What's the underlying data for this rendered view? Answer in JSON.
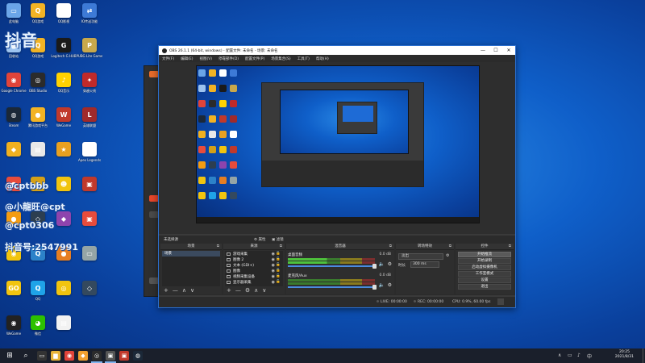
{
  "desktop": {
    "icons": [
      {
        "label": "此电脑",
        "color": "#6aa5e8",
        "glyph": "▭"
      },
      {
        "label": "QQ游戏",
        "color": "#f2b324",
        "glyph": "Q"
      },
      {
        "label": "QQ影视",
        "color": "#ffffff",
        "glyph": "▶"
      },
      {
        "label": "IO传送功能",
        "color": "#3d7ad6",
        "glyph": "⇄"
      },
      {
        "label": "回收站",
        "color": "#9cc3ef",
        "glyph": "🗑"
      },
      {
        "label": "QQ游戏",
        "color": "#f2b324",
        "glyph": "Q"
      },
      {
        "label": "Logitech G HUB",
        "color": "#1a1a1a",
        "glyph": "G"
      },
      {
        "label": "PUBG Lite Game",
        "color": "#c8a84b",
        "glyph": "P"
      },
      {
        "label": "Google Chrome",
        "color": "#e0443a",
        "glyph": "◉"
      },
      {
        "label": "OBS Studio",
        "color": "#2b2b2b",
        "glyph": "◎"
      },
      {
        "label": "QQ音乐",
        "color": "#ffd200",
        "glyph": "♪"
      },
      {
        "label": "穿越火线",
        "color": "#c02a2a",
        "glyph": "✦"
      },
      {
        "label": "Steam",
        "color": "#1b2838",
        "glyph": "◍"
      },
      {
        "label": "腾讯游戏平台",
        "color": "#f2b324",
        "glyph": "●"
      },
      {
        "label": "WeGame",
        "color": "#c0392b",
        "glyph": "W"
      },
      {
        "label": "英雄联盟",
        "color": "#a02a2a",
        "glyph": "L"
      },
      {
        "label": "",
        "color": "#f0b020",
        "glyph": "◆"
      },
      {
        "label": "",
        "color": "#e8e8e8",
        "glyph": "▤"
      },
      {
        "label": "",
        "color": "#e8a020",
        "glyph": "★"
      },
      {
        "label": "Apex Legends",
        "color": "#ffffff",
        "glyph": "▲"
      },
      {
        "label": "",
        "color": "#e74c3c",
        "glyph": "●"
      },
      {
        "label": "",
        "color": "#d4a017",
        "glyph": "◐"
      },
      {
        "label": "",
        "color": "#f1c40f",
        "glyph": "☻"
      },
      {
        "label": "",
        "color": "#c0392b",
        "glyph": "▣"
      },
      {
        "label": "",
        "color": "#f39c12",
        "glyph": "●"
      },
      {
        "label": "",
        "color": "#2c3e50",
        "glyph": "◇"
      },
      {
        "label": "",
        "color": "#8e44ad",
        "glyph": "◆"
      },
      {
        "label": "",
        "color": "#e74c3c",
        "glyph": "▣"
      },
      {
        "label": "",
        "color": "#f1c40f",
        "glyph": "◉"
      },
      {
        "label": "",
        "color": "#2c82c9",
        "glyph": "Q"
      },
      {
        "label": "",
        "color": "#e67e22",
        "glyph": "●"
      },
      {
        "label": "",
        "color": "#95a5a6",
        "glyph": "▭"
      },
      {
        "label": "",
        "color": "#f1c40f",
        "glyph": "GO"
      },
      {
        "label": "QQ",
        "color": "#1fa3e8",
        "glyph": "Q"
      },
      {
        "label": "",
        "color": "#f1c40f",
        "glyph": "◎"
      },
      {
        "label": "",
        "color": "#34495e",
        "glyph": "◇"
      },
      {
        "label": "WeGame",
        "color": "#222222",
        "glyph": "◉"
      },
      {
        "label": "微信",
        "color": "#2dc100",
        "glyph": "◕"
      },
      {
        "label": "",
        "color": "#f2f2f2",
        "glyph": "▤"
      }
    ],
    "watermarks": [
      "抖音",
      "@cptbbb",
      "@小龍旺@cpt",
      "@cpt0306",
      "抖音号:2547991"
    ]
  },
  "obs": {
    "title": "OBS 26.1.1 (64-bit, windows) - 配置文件: 未命名 - 场景: 未命名",
    "window_buttons": [
      "—",
      "☐",
      "✕"
    ],
    "menu": [
      "文件(F)",
      "编辑(E)",
      "视图(V)",
      "停靠部件(D)",
      "配置文件(P)",
      "场景集合(S)",
      "工具(T)",
      "帮助(H)"
    ],
    "scene_bar": {
      "label": "未选择源",
      "properties": "⚙ 属性",
      "filters": "▣ 滤镜"
    },
    "scenes": {
      "header": "场景",
      "items": [
        "场景"
      ]
    },
    "sources": {
      "header": "来源",
      "items": [
        "游戏采集",
        "图像 2",
        "文本 (GDI+)",
        "图像",
        "视频采集设备",
        "显示器采集"
      ]
    },
    "mixer": {
      "header": "混音器",
      "channels": [
        {
          "name": "桌面音频",
          "db": "0.0 dB"
        },
        {
          "name": "麦克风/Aux",
          "db": "0.0 dB"
        }
      ]
    },
    "transitions": {
      "header": "转场特效",
      "selected": "淡出",
      "duration_label": "时长",
      "duration": "300 ms"
    },
    "controls": {
      "header": "控件",
      "buttons": [
        "开始推流",
        "开始录制",
        "启动虚拟摄像机",
        "工作室模式",
        "设置",
        "退出"
      ]
    },
    "status": {
      "live": "LIVE: 00:00:00",
      "rec": "REC: 00:00:00",
      "cpu": "CPU: 0.9%, 60.00 fps"
    },
    "dock_footer": {
      "add": "+",
      "remove": "—",
      "up": "∧",
      "down": "∨",
      "gear": "⚙"
    }
  },
  "taskbar": {
    "start": "⊞",
    "search": "⌕",
    "apps": [
      {
        "glyph": "▭",
        "color": "#333"
      },
      {
        "glyph": "▆",
        "color": "#e8b53a"
      },
      {
        "glyph": "◉",
        "color": "#e0443a"
      },
      {
        "glyph": "◆",
        "color": "#f0a030"
      },
      {
        "glyph": "◎",
        "color": "#2b2b2b"
      },
      {
        "glyph": "▣",
        "color": "#555"
      },
      {
        "glyph": "▣",
        "color": "#c0392b"
      },
      {
        "glyph": "◍",
        "color": "#1b2838"
      }
    ],
    "tray": [
      "∧",
      "▭",
      "♪",
      "中"
    ],
    "time": "20:25",
    "date": "2021/8/31"
  }
}
